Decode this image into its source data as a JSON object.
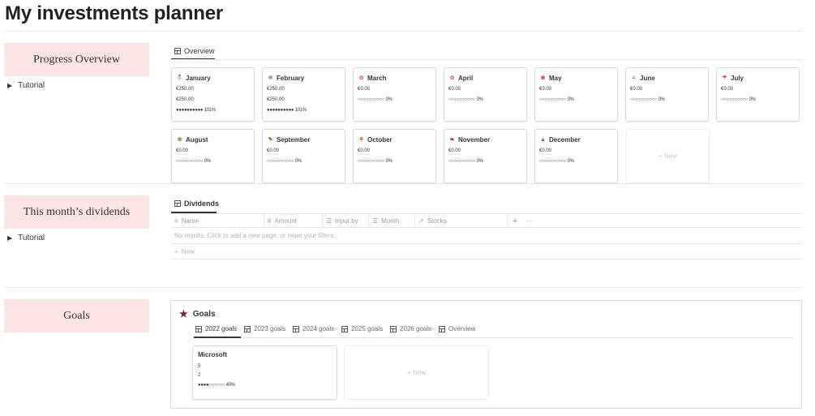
{
  "page": {
    "title": "My investments planner"
  },
  "sections": {
    "progress": {
      "callout": "Progress Overview",
      "toggle": "Tutorial"
    },
    "dividends": {
      "callout": "This month’s dividends",
      "toggle": "Tutorial"
    },
    "goals": {
      "callout": "Goals"
    }
  },
  "overview_tab": {
    "label": "Overview"
  },
  "months": [
    {
      "name": "January",
      "icon": "⛄",
      "line1": "€250.00",
      "line2": "€250.00",
      "progress": "●●●●●●●●●● 101%"
    },
    {
      "name": "February",
      "icon": "❄",
      "line1": "€250.00",
      "line2": "€250.00",
      "progress": "●●●●●●●●●● 101%"
    },
    {
      "name": "March",
      "icon": "✿",
      "line1": "€0.00",
      "line2": "",
      "progress": "○○○○○○○○○○ 0%"
    },
    {
      "name": "April",
      "icon": "✿",
      "line1": "€0.00",
      "line2": "",
      "progress": "○○○○○○○○○○ 0%"
    },
    {
      "name": "May",
      "icon": "❀",
      "line1": "€0.00",
      "line2": "",
      "progress": "○○○○○○○○○○ 0%"
    },
    {
      "name": "June",
      "icon": "≈",
      "line1": "€0.00",
      "line2": "",
      "progress": "○○○○○○○○○○ 0%"
    },
    {
      "name": "July",
      "icon": "☂",
      "line1": "€0.00",
      "line2": "",
      "progress": "○○○○○○○○○○ 0%"
    },
    {
      "name": "August",
      "icon": "❀",
      "line1": "€0.00",
      "line2": "",
      "progress": "○○○○○○○○○○ 0%"
    },
    {
      "name": "September",
      "icon": "✎",
      "line1": "€0.00",
      "line2": "",
      "progress": "○○○○○○○○○○ 0%"
    },
    {
      "name": "October",
      "icon": "⚘",
      "line1": "€0.00",
      "line2": "",
      "progress": "○○○○○○○○○○ 0%"
    },
    {
      "name": "November",
      "icon": "❧",
      "line1": "€0.00",
      "line2": "",
      "progress": "○○○○○○○○○○ 0%"
    },
    {
      "name": "December",
      "icon": "▲",
      "line1": "€0.00",
      "line2": "",
      "progress": "○○○○○○○○○○ 0%"
    }
  ],
  "month_icon_colors": [
    "#c0862b",
    "#5b9bd5",
    "#d9738f",
    "#d9738f",
    "#c0504d",
    "#2e75b6",
    "#c0504d",
    "#7a9a3a",
    "#8c6b3e",
    "#c55a11",
    "#a61c1c",
    "#3f7f3f"
  ],
  "new_label": "New",
  "dividends_tab": {
    "label": "Dividends"
  },
  "dividends_table": {
    "columns": [
      {
        "icon": "≡",
        "label": "Name"
      },
      {
        "icon": "#",
        "label": "Amount"
      },
      {
        "icon": "☰",
        "label": "Input by"
      },
      {
        "icon": "☰",
        "label": "Month"
      },
      {
        "icon": "↗",
        "label": "Stocks"
      }
    ],
    "add_col": "+",
    "more": "···",
    "empty": "No results. Click to add a new page, or reset your filters.",
    "new_row": "New"
  },
  "goals": {
    "title": "Goals",
    "tabs": [
      "2022 goals",
      "2023 goals",
      "2024 goals",
      "2025 goals",
      "2026 goals",
      "Overview"
    ],
    "card": {
      "name": "Microsoft",
      "line1": "5",
      "line2": "2",
      "progress": "●●●●○○○○○○ 40%"
    },
    "new_label": "New"
  },
  "colors": {
    "callout_bg": "#fbe4e4",
    "goals_star": "#7a1a2c"
  }
}
